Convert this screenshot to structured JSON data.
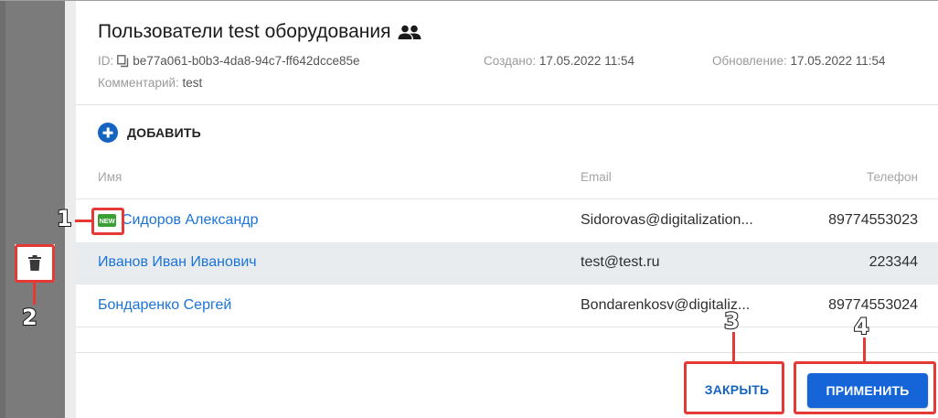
{
  "dialog": {
    "title": "Пользователи test оборудования",
    "id_label": "ID:",
    "id_value": "be77a061-b0b3-4da8-94c7-ff642dcce85e",
    "created_label": "Создано:",
    "created_value": "17.05.2022 11:54",
    "updated_label": "Обновление:",
    "updated_value": "17.05.2022 11:54",
    "comment_label": "Комментарий:",
    "comment_value": "test",
    "add_label": "ДОБАВИТЬ"
  },
  "table": {
    "headers": {
      "name": "Имя",
      "email": "Email",
      "phone": "Телефон"
    },
    "rows": [
      {
        "name": "Сидоров Александр",
        "email": "Sidorovas@digitalization...",
        "phone": "89774553023",
        "badge": "NEW"
      },
      {
        "name": "Иванов Иван Иванович",
        "email": "test@test.ru",
        "phone": "223344"
      },
      {
        "name": "Бондаренко Сергей",
        "email": "Bondarenkosv@digitaliz...",
        "phone": "89774553024"
      }
    ]
  },
  "footer": {
    "close_label": "ЗАКРЫТЬ",
    "apply_label": "ПРИМЕНИТЬ"
  },
  "annotations": [
    "1",
    "2",
    "3",
    "4"
  ],
  "colors": {
    "accent": "#1565d8",
    "link": "#1a73d9",
    "annotation": "#e53935",
    "badge_new": "#3aa035"
  },
  "icons": [
    "people-icon",
    "copy-icon",
    "add-circle-icon",
    "new-badge-icon",
    "trash-icon"
  ]
}
